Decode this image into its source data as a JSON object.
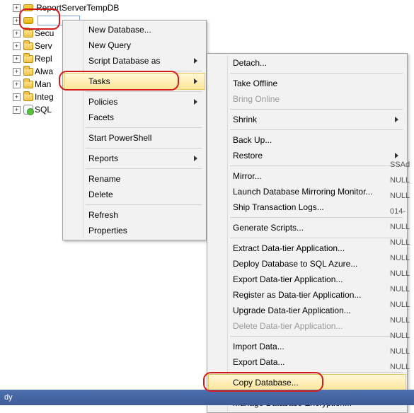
{
  "tree": {
    "items": [
      {
        "label": "ReportServerTempDB",
        "icon": "db"
      },
      {
        "label": "",
        "icon": "db",
        "rename": true
      },
      {
        "label": "Secu",
        "icon": "folder"
      },
      {
        "label": "Serv",
        "icon": "folder"
      },
      {
        "label": "Repl",
        "icon": "folder"
      },
      {
        "label": "Alwa",
        "icon": "folder"
      },
      {
        "label": "Man",
        "icon": "folder"
      },
      {
        "label": "Integ",
        "icon": "folder"
      },
      {
        "label": "SQL",
        "icon": "sql"
      }
    ]
  },
  "menu1": [
    {
      "label": "New Database..."
    },
    {
      "label": "New Query"
    },
    {
      "label": "Script Database as",
      "sub": true
    },
    {
      "sep": true
    },
    {
      "label": "Tasks",
      "sub": true,
      "hovered": true,
      "highlight": true
    },
    {
      "sep": true
    },
    {
      "label": "Policies",
      "sub": true
    },
    {
      "label": "Facets"
    },
    {
      "sep": true
    },
    {
      "label": "Start PowerShell"
    },
    {
      "sep": true
    },
    {
      "label": "Reports",
      "sub": true
    },
    {
      "sep": true
    },
    {
      "label": "Rename"
    },
    {
      "label": "Delete"
    },
    {
      "sep": true
    },
    {
      "label": "Refresh"
    },
    {
      "label": "Properties"
    }
  ],
  "menu2": [
    {
      "label": "Detach..."
    },
    {
      "sep": true
    },
    {
      "label": "Take Offline"
    },
    {
      "label": "Bring Online",
      "disabled": true
    },
    {
      "sep": true
    },
    {
      "label": "Shrink",
      "sub": true
    },
    {
      "sep": true
    },
    {
      "label": "Back Up..."
    },
    {
      "label": "Restore",
      "sub": true
    },
    {
      "sep": true
    },
    {
      "label": "Mirror..."
    },
    {
      "label": "Launch Database Mirroring Monitor..."
    },
    {
      "label": "Ship Transaction Logs..."
    },
    {
      "sep": true
    },
    {
      "label": "Generate Scripts..."
    },
    {
      "sep": true
    },
    {
      "label": "Extract Data-tier Application..."
    },
    {
      "label": "Deploy Database to SQL Azure..."
    },
    {
      "label": "Export Data-tier Application..."
    },
    {
      "label": "Register as Data-tier Application..."
    },
    {
      "label": "Upgrade Data-tier Application..."
    },
    {
      "label": "Delete Data-tier Application...",
      "disabled": true
    },
    {
      "sep": true
    },
    {
      "label": "Import Data..."
    },
    {
      "label": "Export Data..."
    },
    {
      "sep": true
    },
    {
      "label": "Copy Database...",
      "hovered": true,
      "highlight": true
    },
    {
      "sep": true
    },
    {
      "label": "Manage Database Encryption..."
    }
  ],
  "right_values": [
    "SSAd",
    "NULL",
    "NULL",
    "014-",
    "NULL",
    "NULL",
    "NULL",
    "NULL",
    "NULL",
    "NULL",
    "NULL",
    "NULL",
    "NULL",
    "NULL"
  ],
  "statusbar": {
    "text": "dy"
  }
}
